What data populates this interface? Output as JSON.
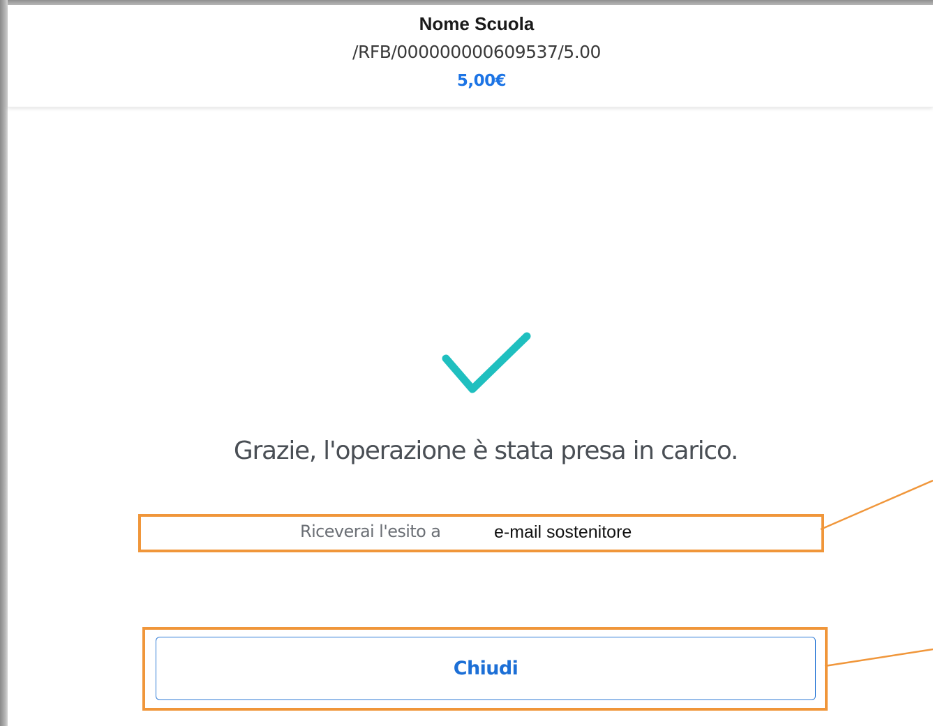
{
  "header": {
    "school_name": "Nome Scuola",
    "payment_reference": "/RFB/000000000609537/5.00",
    "amount": "5,00€"
  },
  "confirmation": {
    "icon": "checkmark-icon",
    "message": "Grazie, l'operazione è stata presa in carico.",
    "email_prefix": "Riceverai l'esito a",
    "email_value": "e-mail sostenitore"
  },
  "actions": {
    "close_label": "Chiudi"
  },
  "colors": {
    "accent_blue": "#1c74e5",
    "check_teal": "#1fbfbf",
    "highlight_orange": "#f0963a"
  }
}
